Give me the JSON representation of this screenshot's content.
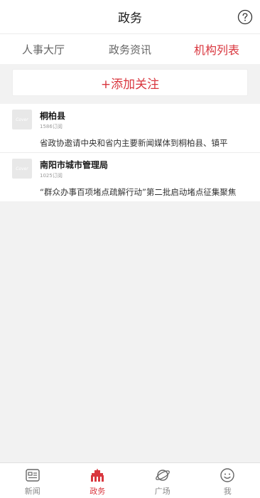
{
  "header": {
    "title": "政务"
  },
  "tabs": [
    {
      "label": "人事大厅"
    },
    {
      "label": "政务资讯"
    },
    {
      "label": "机构列表"
    }
  ],
  "add_button": {
    "label": "+添加关注"
  },
  "orgs": [
    {
      "logo_text": "Cover",
      "name": "桐柏县",
      "subscribers": "1586订阅",
      "latest": "省政协邀请中央和省内主要新闻媒体到桐柏县、镇平"
    },
    {
      "logo_text": "Cover",
      "name": "南阳市城市管理局",
      "subscribers": "1025订阅",
      "latest": "“群众办事百项堵点疏解行动”第二批启动堵点征集聚焦"
    }
  ],
  "nav": [
    {
      "label": "新闻",
      "icon": "news-icon"
    },
    {
      "label": "政务",
      "icon": "government-building-icon"
    },
    {
      "label": "广场",
      "icon": "planet-icon"
    },
    {
      "label": "我",
      "icon": "user-icon"
    }
  ],
  "colors": {
    "accent": "#d9363e",
    "text_muted": "#888888",
    "background": "#f2f2f2"
  }
}
